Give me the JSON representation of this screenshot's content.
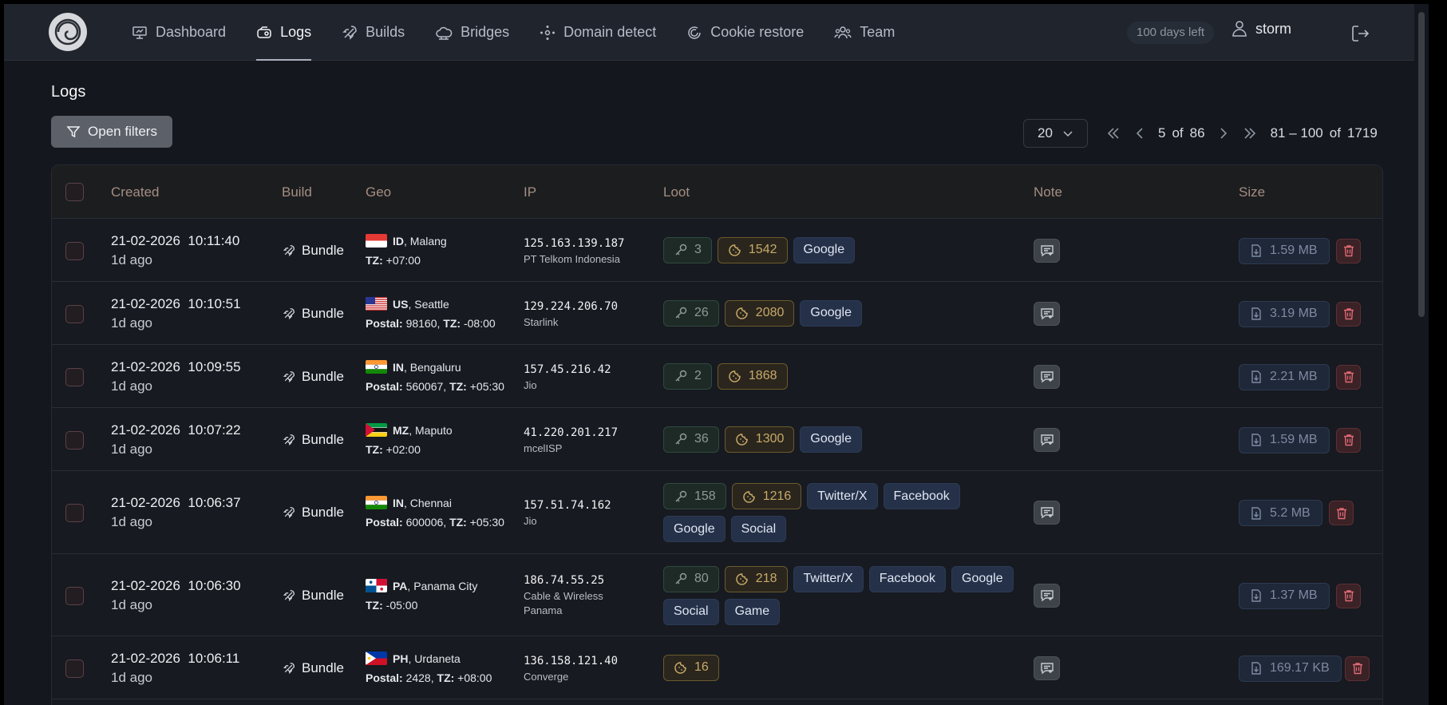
{
  "nav": {
    "items": [
      {
        "label": "Dashboard",
        "icon": "dashboard-icon",
        "active": false
      },
      {
        "label": "Logs",
        "icon": "logs-icon",
        "active": true
      },
      {
        "label": "Builds",
        "icon": "rocket-icon",
        "active": false
      },
      {
        "label": "Bridges",
        "icon": "cloud-icon",
        "active": false
      },
      {
        "label": "Domain detect",
        "icon": "network-icon",
        "active": false
      },
      {
        "label": "Cookie restore",
        "icon": "restore-icon",
        "active": false
      },
      {
        "label": "Team",
        "icon": "team-icon",
        "active": false
      }
    ],
    "days_left": "100 days left",
    "user": "storm"
  },
  "page": {
    "title": "Logs",
    "filters_label": "Open filters"
  },
  "pager": {
    "page_size": "20",
    "current": "5",
    "of_label": "of",
    "total_pages": "86",
    "range": "81 – 100",
    "total": "1719"
  },
  "table": {
    "headers": {
      "created": "Created",
      "build": "Build",
      "geo": "Geo",
      "ip": "IP",
      "loot": "Loot",
      "note": "Note",
      "size": "Size"
    },
    "rows": [
      {
        "date": "21-02-2026",
        "time": "10:11:40",
        "ago": "1d ago",
        "build": "Bundle",
        "country": "ID",
        "city": "Malang",
        "flag": "ID",
        "postal_label": "",
        "postal": "",
        "tz_label": "TZ:",
        "tz": "+07:00",
        "ip": "125.163.139.187",
        "isp": "PT Telkom Indonesia",
        "passwords": "3",
        "cookies": "1542",
        "services": [
          "Google"
        ],
        "size": "1.59 MB"
      },
      {
        "date": "21-02-2026",
        "time": "10:10:51",
        "ago": "1d ago",
        "build": "Bundle",
        "country": "US",
        "city": "Seattle",
        "flag": "US",
        "postal_label": "Postal:",
        "postal": "98160,",
        "tz_label": "TZ:",
        "tz": "-08:00",
        "ip": "129.224.206.70",
        "isp": "Starlink",
        "passwords": "26",
        "cookies": "2080",
        "services": [
          "Google"
        ],
        "size": "3.19 MB"
      },
      {
        "date": "21-02-2026",
        "time": "10:09:55",
        "ago": "1d ago",
        "build": "Bundle",
        "country": "IN",
        "city": "Bengaluru",
        "flag": "IN",
        "postal_label": "Postal:",
        "postal": "560067,",
        "tz_label": "TZ:",
        "tz": "+05:30",
        "ip": "157.45.216.42",
        "isp": "Jio",
        "passwords": "2",
        "cookies": "1868",
        "services": [],
        "size": "2.21 MB"
      },
      {
        "date": "21-02-2026",
        "time": "10:07:22",
        "ago": "1d ago",
        "build": "Bundle",
        "country": "MZ",
        "city": "Maputo",
        "flag": "MZ",
        "postal_label": "",
        "postal": "",
        "tz_label": "TZ:",
        "tz": "+02:00",
        "ip": "41.220.201.217",
        "isp": "mcelISP",
        "passwords": "36",
        "cookies": "1300",
        "services": [
          "Google"
        ],
        "size": "1.59 MB"
      },
      {
        "date": "21-02-2026",
        "time": "10:06:37",
        "ago": "1d ago",
        "build": "Bundle",
        "country": "IN",
        "city": "Chennai",
        "flag": "IN",
        "postal_label": "Postal:",
        "postal": "600006,",
        "tz_label": "TZ:",
        "tz": "+05:30",
        "ip": "157.51.74.162",
        "isp": "Jio",
        "passwords": "158",
        "cookies": "1216",
        "services": [
          "Twitter/X",
          "Facebook",
          "Google",
          "Social"
        ],
        "size": "5.2 MB"
      },
      {
        "date": "21-02-2026",
        "time": "10:06:30",
        "ago": "1d ago",
        "build": "Bundle",
        "country": "PA",
        "city": "Panama City",
        "flag": "PA",
        "postal_label": "",
        "postal": "",
        "tz_label": "TZ:",
        "tz": "-05:00",
        "ip": "186.74.55.25",
        "isp": "Cable & Wireless Panama",
        "passwords": "80",
        "cookies": "218",
        "services": [
          "Twitter/X",
          "Facebook",
          "Google",
          "Social",
          "Game"
        ],
        "size": "1.37 MB"
      },
      {
        "date": "21-02-2026",
        "time": "10:06:11",
        "ago": "1d ago",
        "build": "Bundle",
        "country": "PH",
        "city": "Urdaneta",
        "flag": "PH",
        "postal_label": "Postal:",
        "postal": "2428,",
        "tz_label": "TZ:",
        "tz": "+08:00",
        "ip": "136.158.121.40",
        "isp": "Converge",
        "passwords": "",
        "cookies": "16",
        "services": [],
        "size": "169.17 KB"
      }
    ]
  }
}
